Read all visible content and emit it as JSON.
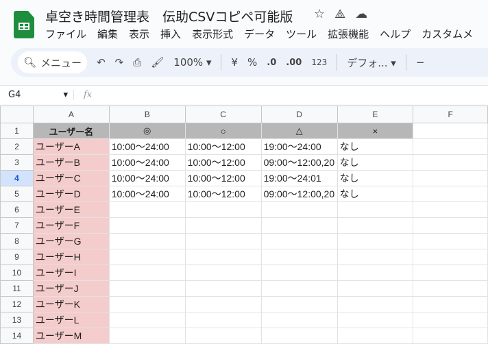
{
  "title": "卓空き時間管理表　伝助CSVコピペ可能版",
  "menu": [
    "ファイル",
    "編集",
    "表示",
    "挿入",
    "表示形式",
    "データ",
    "ツール",
    "拡張機能",
    "ヘルプ",
    "カスタムメ"
  ],
  "toolbar": {
    "search": "メニュー",
    "zoom": "100%",
    "currency": "¥",
    "percent": "%",
    "dec_decrease": ".0",
    "dec_increase": ".00",
    "number_format": "123",
    "font": "デフォ..."
  },
  "name_box": "G4",
  "fx": "fx",
  "columns": [
    "A",
    "B",
    "C",
    "D",
    "E",
    "F"
  ],
  "header_row": [
    "ユーザー名",
    "◎",
    "○",
    "△",
    "×",
    ""
  ],
  "rows": [
    [
      "ユーザーA",
      "10:00～24:00",
      "10:00～12:00",
      "19:00～24:00",
      "なし"
    ],
    [
      "ユーザーB",
      "10:00～24:00",
      "10:00～12:00",
      "09:00～12:00,20",
      "なし"
    ],
    [
      "ユーザーC",
      "10:00～24:00",
      "10:00～12:00",
      "19:00～24:01",
      "なし"
    ],
    [
      "ユーザーD",
      "10:00～24:00",
      "10:00～12:00",
      "09:00～12:00,20",
      "なし"
    ],
    [
      "ユーザーE",
      "",
      "",
      "",
      ""
    ],
    [
      "ユーザーF",
      "",
      "",
      "",
      ""
    ],
    [
      "ユーザーG",
      "",
      "",
      "",
      ""
    ],
    [
      "ユーザーH",
      "",
      "",
      "",
      ""
    ],
    [
      "ユーザーI",
      "",
      "",
      "",
      ""
    ],
    [
      "ユーザーJ",
      "",
      "",
      "",
      ""
    ],
    [
      "ユーザーK",
      "",
      "",
      "",
      ""
    ],
    [
      "ユーザーL",
      "",
      "",
      "",
      ""
    ],
    [
      "ユーザーM",
      "",
      "",
      "",
      ""
    ]
  ]
}
